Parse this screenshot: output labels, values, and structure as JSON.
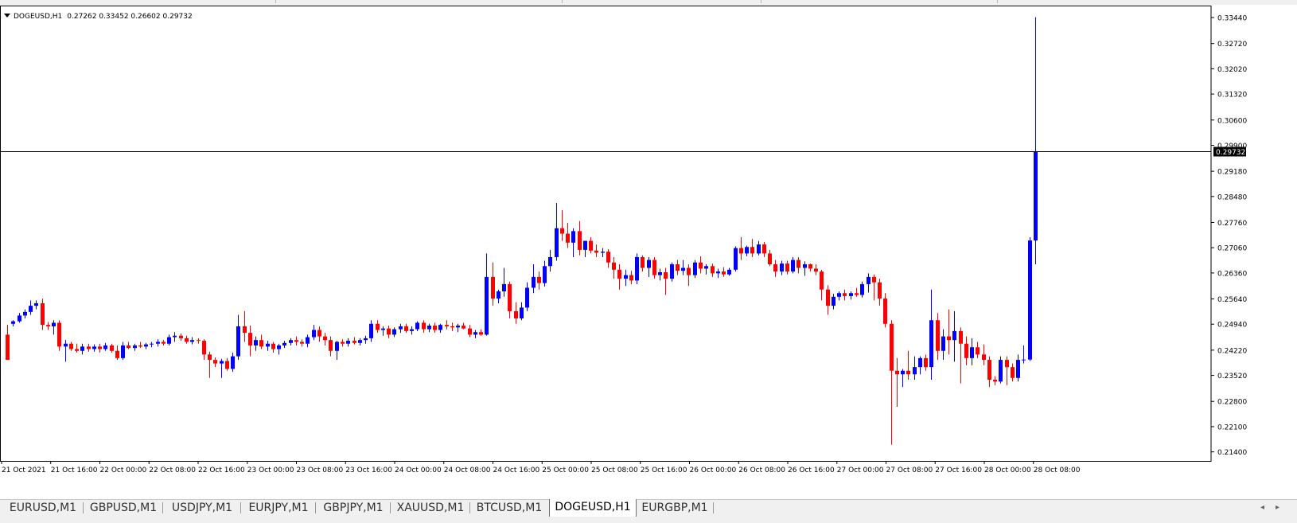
{
  "chart_header": {
    "symbol": "DOGEUSD,H1",
    "ohlc": "0.27262 0.33452 0.26602 0.29732"
  },
  "current_price": "0.29732",
  "colors": {
    "bull": "#0000ff",
    "bear": "#ff0000",
    "grid": "#000000",
    "price_tag_bg": "#000000"
  },
  "chart_data": {
    "type": "candlestick",
    "title": "DOGEUSD,H1",
    "ylim": [
      0.2115,
      0.3375
    ],
    "y_ticks": [
      "0.33440",
      "0.32720",
      "0.32020",
      "0.31320",
      "0.30600",
      "0.29900",
      "0.29180",
      "0.28480",
      "0.27760",
      "0.27060",
      "0.26360",
      "0.25640",
      "0.24940",
      "0.24220",
      "0.23520",
      "0.22800",
      "0.22100",
      "0.21400"
    ],
    "x_ticks": [
      "21 Oct 2021",
      "21 Oct 16:00",
      "22 Oct 00:00",
      "22 Oct 08:00",
      "22 Oct 16:00",
      "23 Oct 00:00",
      "23 Oct 08:00",
      "23 Oct 16:00",
      "24 Oct 00:00",
      "24 Oct 08:00",
      "24 Oct 16:00",
      "25 Oct 00:00",
      "25 Oct 08:00",
      "25 Oct 16:00",
      "26 Oct 00:00",
      "26 Oct 08:00",
      "26 Oct 16:00",
      "27 Oct 00:00",
      "27 Oct 08:00",
      "27 Oct 16:00",
      "28 Oct 00:00",
      "28 Oct 08:00"
    ],
    "current_price": 0.29732,
    "candles": [
      [
        0.2465,
        0.2492,
        0.2395,
        0.2395
      ],
      [
        0.2495,
        0.2505,
        0.2488,
        0.2502
      ],
      [
        0.2502,
        0.2525,
        0.2498,
        0.2518
      ],
      [
        0.2518,
        0.2535,
        0.251,
        0.2528
      ],
      [
        0.2528,
        0.256,
        0.252,
        0.2545
      ],
      [
        0.2545,
        0.256,
        0.2535,
        0.2552
      ],
      [
        0.2552,
        0.2565,
        0.2478,
        0.2492
      ],
      [
        0.2492,
        0.25,
        0.2478,
        0.2488
      ],
      [
        0.2488,
        0.2505,
        0.2465,
        0.2498
      ],
      [
        0.2498,
        0.2505,
        0.242,
        0.2432
      ],
      [
        0.2432,
        0.245,
        0.239,
        0.244
      ],
      [
        0.244,
        0.2445,
        0.242,
        0.2425
      ],
      [
        0.2425,
        0.244,
        0.2415,
        0.242
      ],
      [
        0.242,
        0.244,
        0.241,
        0.2432
      ],
      [
        0.2432,
        0.244,
        0.2418,
        0.2425
      ],
      [
        0.2425,
        0.2438,
        0.2418,
        0.2432
      ],
      [
        0.2432,
        0.244,
        0.2415,
        0.2425
      ],
      [
        0.2425,
        0.2442,
        0.242,
        0.2435
      ],
      [
        0.2435,
        0.244,
        0.2415,
        0.242
      ],
      [
        0.242,
        0.2435,
        0.2395,
        0.24
      ],
      [
        0.24,
        0.2445,
        0.2395,
        0.2435
      ],
      [
        0.2435,
        0.2445,
        0.2425,
        0.2428
      ],
      [
        0.2428,
        0.244,
        0.242,
        0.2435
      ],
      [
        0.2435,
        0.2445,
        0.2428,
        0.2432
      ],
      [
        0.2432,
        0.2442,
        0.2425,
        0.2438
      ],
      [
        0.2438,
        0.2445,
        0.243,
        0.244
      ],
      [
        0.244,
        0.2452,
        0.2432,
        0.2445
      ],
      [
        0.2445,
        0.245,
        0.2435,
        0.244
      ],
      [
        0.244,
        0.2465,
        0.2435,
        0.2458
      ],
      [
        0.2458,
        0.2472,
        0.2445,
        0.2462
      ],
      [
        0.2462,
        0.2468,
        0.2448,
        0.2455
      ],
      [
        0.2455,
        0.2462,
        0.244,
        0.2445
      ],
      [
        0.2445,
        0.2458,
        0.2438,
        0.245
      ],
      [
        0.245,
        0.2455,
        0.244,
        0.2448
      ],
      [
        0.2448,
        0.2452,
        0.2395,
        0.241
      ],
      [
        0.241,
        0.2418,
        0.2345,
        0.2395
      ],
      [
        0.2395,
        0.2402,
        0.2375,
        0.2385
      ],
      [
        0.2385,
        0.2398,
        0.2345,
        0.2392
      ],
      [
        0.2392,
        0.24,
        0.2365,
        0.237
      ],
      [
        0.237,
        0.2415,
        0.2362,
        0.2405
      ],
      [
        0.2405,
        0.252,
        0.2395,
        0.2488
      ],
      [
        0.2488,
        0.253,
        0.2445,
        0.247
      ],
      [
        0.247,
        0.249,
        0.2405,
        0.2435
      ],
      [
        0.2435,
        0.246,
        0.242,
        0.245
      ],
      [
        0.245,
        0.2465,
        0.2425,
        0.2432
      ],
      [
        0.2432,
        0.2448,
        0.242,
        0.244
      ],
      [
        0.244,
        0.2445,
        0.2415,
        0.2425
      ],
      [
        0.2425,
        0.244,
        0.241,
        0.2435
      ],
      [
        0.2435,
        0.2448,
        0.2428,
        0.2442
      ],
      [
        0.2442,
        0.2455,
        0.2435,
        0.245
      ],
      [
        0.245,
        0.246,
        0.2435,
        0.2445
      ],
      [
        0.2445,
        0.2452,
        0.2432,
        0.244
      ],
      [
        0.244,
        0.2465,
        0.243,
        0.2458
      ],
      [
        0.2458,
        0.2492,
        0.245,
        0.2478
      ],
      [
        0.2478,
        0.2488,
        0.2445,
        0.246
      ],
      [
        0.246,
        0.247,
        0.2435,
        0.245
      ],
      [
        0.245,
        0.246,
        0.2405,
        0.242
      ],
      [
        0.242,
        0.2448,
        0.2395,
        0.2445
      ],
      [
        0.2445,
        0.2452,
        0.2432,
        0.244
      ],
      [
        0.244,
        0.2455,
        0.2432,
        0.2448
      ],
      [
        0.2448,
        0.2458,
        0.2438,
        0.2442
      ],
      [
        0.2442,
        0.2455,
        0.2435,
        0.245
      ],
      [
        0.245,
        0.2462,
        0.244,
        0.2455
      ],
      [
        0.2455,
        0.2505,
        0.2445,
        0.2495
      ],
      [
        0.2495,
        0.2505,
        0.247,
        0.2478
      ],
      [
        0.2478,
        0.2488,
        0.2462,
        0.2482
      ],
      [
        0.2482,
        0.249,
        0.2455,
        0.2465
      ],
      [
        0.2465,
        0.2485,
        0.2458,
        0.248
      ],
      [
        0.248,
        0.2495,
        0.247,
        0.2488
      ],
      [
        0.2488,
        0.2495,
        0.247,
        0.2475
      ],
      [
        0.2475,
        0.2488,
        0.2465,
        0.248
      ],
      [
        0.248,
        0.2502,
        0.2475,
        0.2498
      ],
      [
        0.2498,
        0.2505,
        0.247,
        0.248
      ],
      [
        0.248,
        0.2495,
        0.2472,
        0.249
      ],
      [
        0.249,
        0.2498,
        0.247,
        0.2478
      ],
      [
        0.2478,
        0.2495,
        0.247,
        0.2492
      ],
      [
        0.2492,
        0.2505,
        0.248,
        0.2488
      ],
      [
        0.2488,
        0.2498,
        0.2475,
        0.2485
      ],
      [
        0.2485,
        0.2495,
        0.2472,
        0.249
      ],
      [
        0.249,
        0.2498,
        0.248,
        0.2482
      ],
      [
        0.2482,
        0.2492,
        0.2458,
        0.2465
      ],
      [
        0.2465,
        0.2478,
        0.2455,
        0.2472
      ],
      [
        0.2472,
        0.248,
        0.2462,
        0.2465
      ],
      [
        0.2465,
        0.269,
        0.2462,
        0.2625
      ],
      [
        0.2625,
        0.2665,
        0.2545,
        0.2565
      ],
      [
        0.2565,
        0.259,
        0.2552,
        0.2585
      ],
      [
        0.2585,
        0.265,
        0.257,
        0.2605
      ],
      [
        0.2605,
        0.2612,
        0.251,
        0.253
      ],
      [
        0.253,
        0.2555,
        0.2495,
        0.251
      ],
      [
        0.251,
        0.2555,
        0.2505,
        0.254
      ],
      [
        0.254,
        0.261,
        0.253,
        0.2595
      ],
      [
        0.2595,
        0.266,
        0.258,
        0.2625
      ],
      [
        0.2625,
        0.264,
        0.259,
        0.2608
      ],
      [
        0.2608,
        0.267,
        0.2598,
        0.2655
      ],
      [
        0.2655,
        0.27,
        0.264,
        0.268
      ],
      [
        0.268,
        0.283,
        0.267,
        0.276
      ],
      [
        0.276,
        0.281,
        0.2725,
        0.2745
      ],
      [
        0.2745,
        0.2775,
        0.2705,
        0.272
      ],
      [
        0.272,
        0.276,
        0.268,
        0.2752
      ],
      [
        0.2752,
        0.278,
        0.2685,
        0.27
      ],
      [
        0.27,
        0.2725,
        0.268,
        0.2725
      ],
      [
        0.2725,
        0.2735,
        0.269,
        0.2698
      ],
      [
        0.2698,
        0.2715,
        0.268,
        0.2692
      ],
      [
        0.2692,
        0.2705,
        0.268,
        0.2695
      ],
      [
        0.2695,
        0.2702,
        0.265,
        0.2665
      ],
      [
        0.2665,
        0.268,
        0.262,
        0.2645
      ],
      [
        0.2645,
        0.266,
        0.259,
        0.262
      ],
      [
        0.262,
        0.2645,
        0.26,
        0.263
      ],
      [
        0.263,
        0.2642,
        0.2605,
        0.2615
      ],
      [
        0.2615,
        0.269,
        0.2605,
        0.268
      ],
      [
        0.268,
        0.2685,
        0.264,
        0.265
      ],
      [
        0.265,
        0.268,
        0.2625,
        0.2672
      ],
      [
        0.2672,
        0.268,
        0.262,
        0.263
      ],
      [
        0.263,
        0.2648,
        0.2615,
        0.2638
      ],
      [
        0.2638,
        0.265,
        0.2575,
        0.262
      ],
      [
        0.262,
        0.2665,
        0.2612,
        0.266
      ],
      [
        0.266,
        0.2672,
        0.263,
        0.2642
      ],
      [
        0.2642,
        0.2672,
        0.263,
        0.265
      ],
      [
        0.265,
        0.266,
        0.26,
        0.263
      ],
      [
        0.263,
        0.2672,
        0.2622,
        0.2665
      ],
      [
        0.2665,
        0.2682,
        0.2635,
        0.2648
      ],
      [
        0.2648,
        0.266,
        0.2632,
        0.2655
      ],
      [
        0.2655,
        0.2662,
        0.2625,
        0.2635
      ],
      [
        0.2635,
        0.2648,
        0.2622,
        0.264
      ],
      [
        0.264,
        0.2652,
        0.2625,
        0.2632
      ],
      [
        0.2632,
        0.265,
        0.2628,
        0.2645
      ],
      [
        0.2645,
        0.271,
        0.264,
        0.2705
      ],
      [
        0.2705,
        0.2735,
        0.2672,
        0.269
      ],
      [
        0.269,
        0.2712,
        0.2682,
        0.2708
      ],
      [
        0.2708,
        0.273,
        0.268,
        0.269
      ],
      [
        0.269,
        0.2725,
        0.2685,
        0.2715
      ],
      [
        0.2715,
        0.2722,
        0.268,
        0.269
      ],
      [
        0.269,
        0.27,
        0.2655,
        0.266
      ],
      [
        0.266,
        0.2672,
        0.2625,
        0.264
      ],
      [
        0.264,
        0.267,
        0.263,
        0.2662
      ],
      [
        0.2662,
        0.267,
        0.2632,
        0.264
      ],
      [
        0.264,
        0.268,
        0.2635,
        0.2672
      ],
      [
        0.2672,
        0.268,
        0.2635,
        0.265
      ],
      [
        0.265,
        0.2668,
        0.2628,
        0.266
      ],
      [
        0.266,
        0.2662,
        0.264,
        0.2648
      ],
      [
        0.2648,
        0.266,
        0.263,
        0.264
      ],
      [
        0.264,
        0.2645,
        0.256,
        0.259
      ],
      [
        0.259,
        0.2602,
        0.252,
        0.2545
      ],
      [
        0.2545,
        0.2578,
        0.2535,
        0.257
      ],
      [
        0.257,
        0.2585,
        0.256,
        0.258
      ],
      [
        0.258,
        0.259,
        0.256,
        0.2572
      ],
      [
        0.2572,
        0.2585,
        0.2562,
        0.258
      ],
      [
        0.258,
        0.2595,
        0.257,
        0.2575
      ],
      [
        0.2575,
        0.2612,
        0.2568,
        0.2605
      ],
      [
        0.2605,
        0.2635,
        0.2582,
        0.2625
      ],
      [
        0.2625,
        0.2632,
        0.256,
        0.261
      ],
      [
        0.261,
        0.262,
        0.2545,
        0.2565
      ],
      [
        0.2565,
        0.258,
        0.2485,
        0.2495
      ],
      [
        0.2495,
        0.2505,
        0.216,
        0.2365
      ],
      [
        0.2365,
        0.24,
        0.2265,
        0.2355
      ],
      [
        0.2355,
        0.237,
        0.232,
        0.2365
      ],
      [
        0.2365,
        0.242,
        0.234,
        0.2355
      ],
      [
        0.2355,
        0.2405,
        0.234,
        0.2375
      ],
      [
        0.2375,
        0.2405,
        0.2355,
        0.24
      ],
      [
        0.24,
        0.241,
        0.2365,
        0.2375
      ],
      [
        0.2375,
        0.259,
        0.234,
        0.2505
      ],
      [
        0.2505,
        0.2525,
        0.2395,
        0.242
      ],
      [
        0.242,
        0.248,
        0.2395,
        0.246
      ],
      [
        0.246,
        0.2535,
        0.241,
        0.245
      ],
      [
        0.245,
        0.253,
        0.239,
        0.2475
      ],
      [
        0.2475,
        0.2485,
        0.233,
        0.244
      ],
      [
        0.244,
        0.246,
        0.238,
        0.24
      ],
      [
        0.24,
        0.2455,
        0.238,
        0.243
      ],
      [
        0.243,
        0.2445,
        0.24,
        0.241
      ],
      [
        0.241,
        0.2438,
        0.238,
        0.2395
      ],
      [
        0.2395,
        0.2405,
        0.232,
        0.234
      ],
      [
        0.234,
        0.235,
        0.2325,
        0.2335
      ],
      [
        0.2335,
        0.2405,
        0.233,
        0.2395
      ],
      [
        0.2395,
        0.2405,
        0.2325,
        0.2375
      ],
      [
        0.2375,
        0.2385,
        0.2335,
        0.2345
      ],
      [
        0.2345,
        0.241,
        0.2335,
        0.2395
      ],
      [
        0.2395,
        0.2435,
        0.2385,
        0.2396
      ],
      [
        0.2396,
        0.2735,
        0.2392,
        0.2726
      ],
      [
        0.2726,
        0.3345,
        0.266,
        0.2973
      ]
    ]
  },
  "tabs": [
    {
      "label": "EURUSD,M1"
    },
    {
      "label": "GBPUSD,M1"
    },
    {
      "label": "USDJPY,M1"
    },
    {
      "label": "EURJPY,M1"
    },
    {
      "label": "GBPJPY,M1"
    },
    {
      "label": "XAUUSD,M1"
    },
    {
      "label": "BTCUSD,M1"
    },
    {
      "label": "DOGEUSD,H1"
    },
    {
      "label": "EURGBP,M1"
    }
  ],
  "active_tab_index": 7
}
